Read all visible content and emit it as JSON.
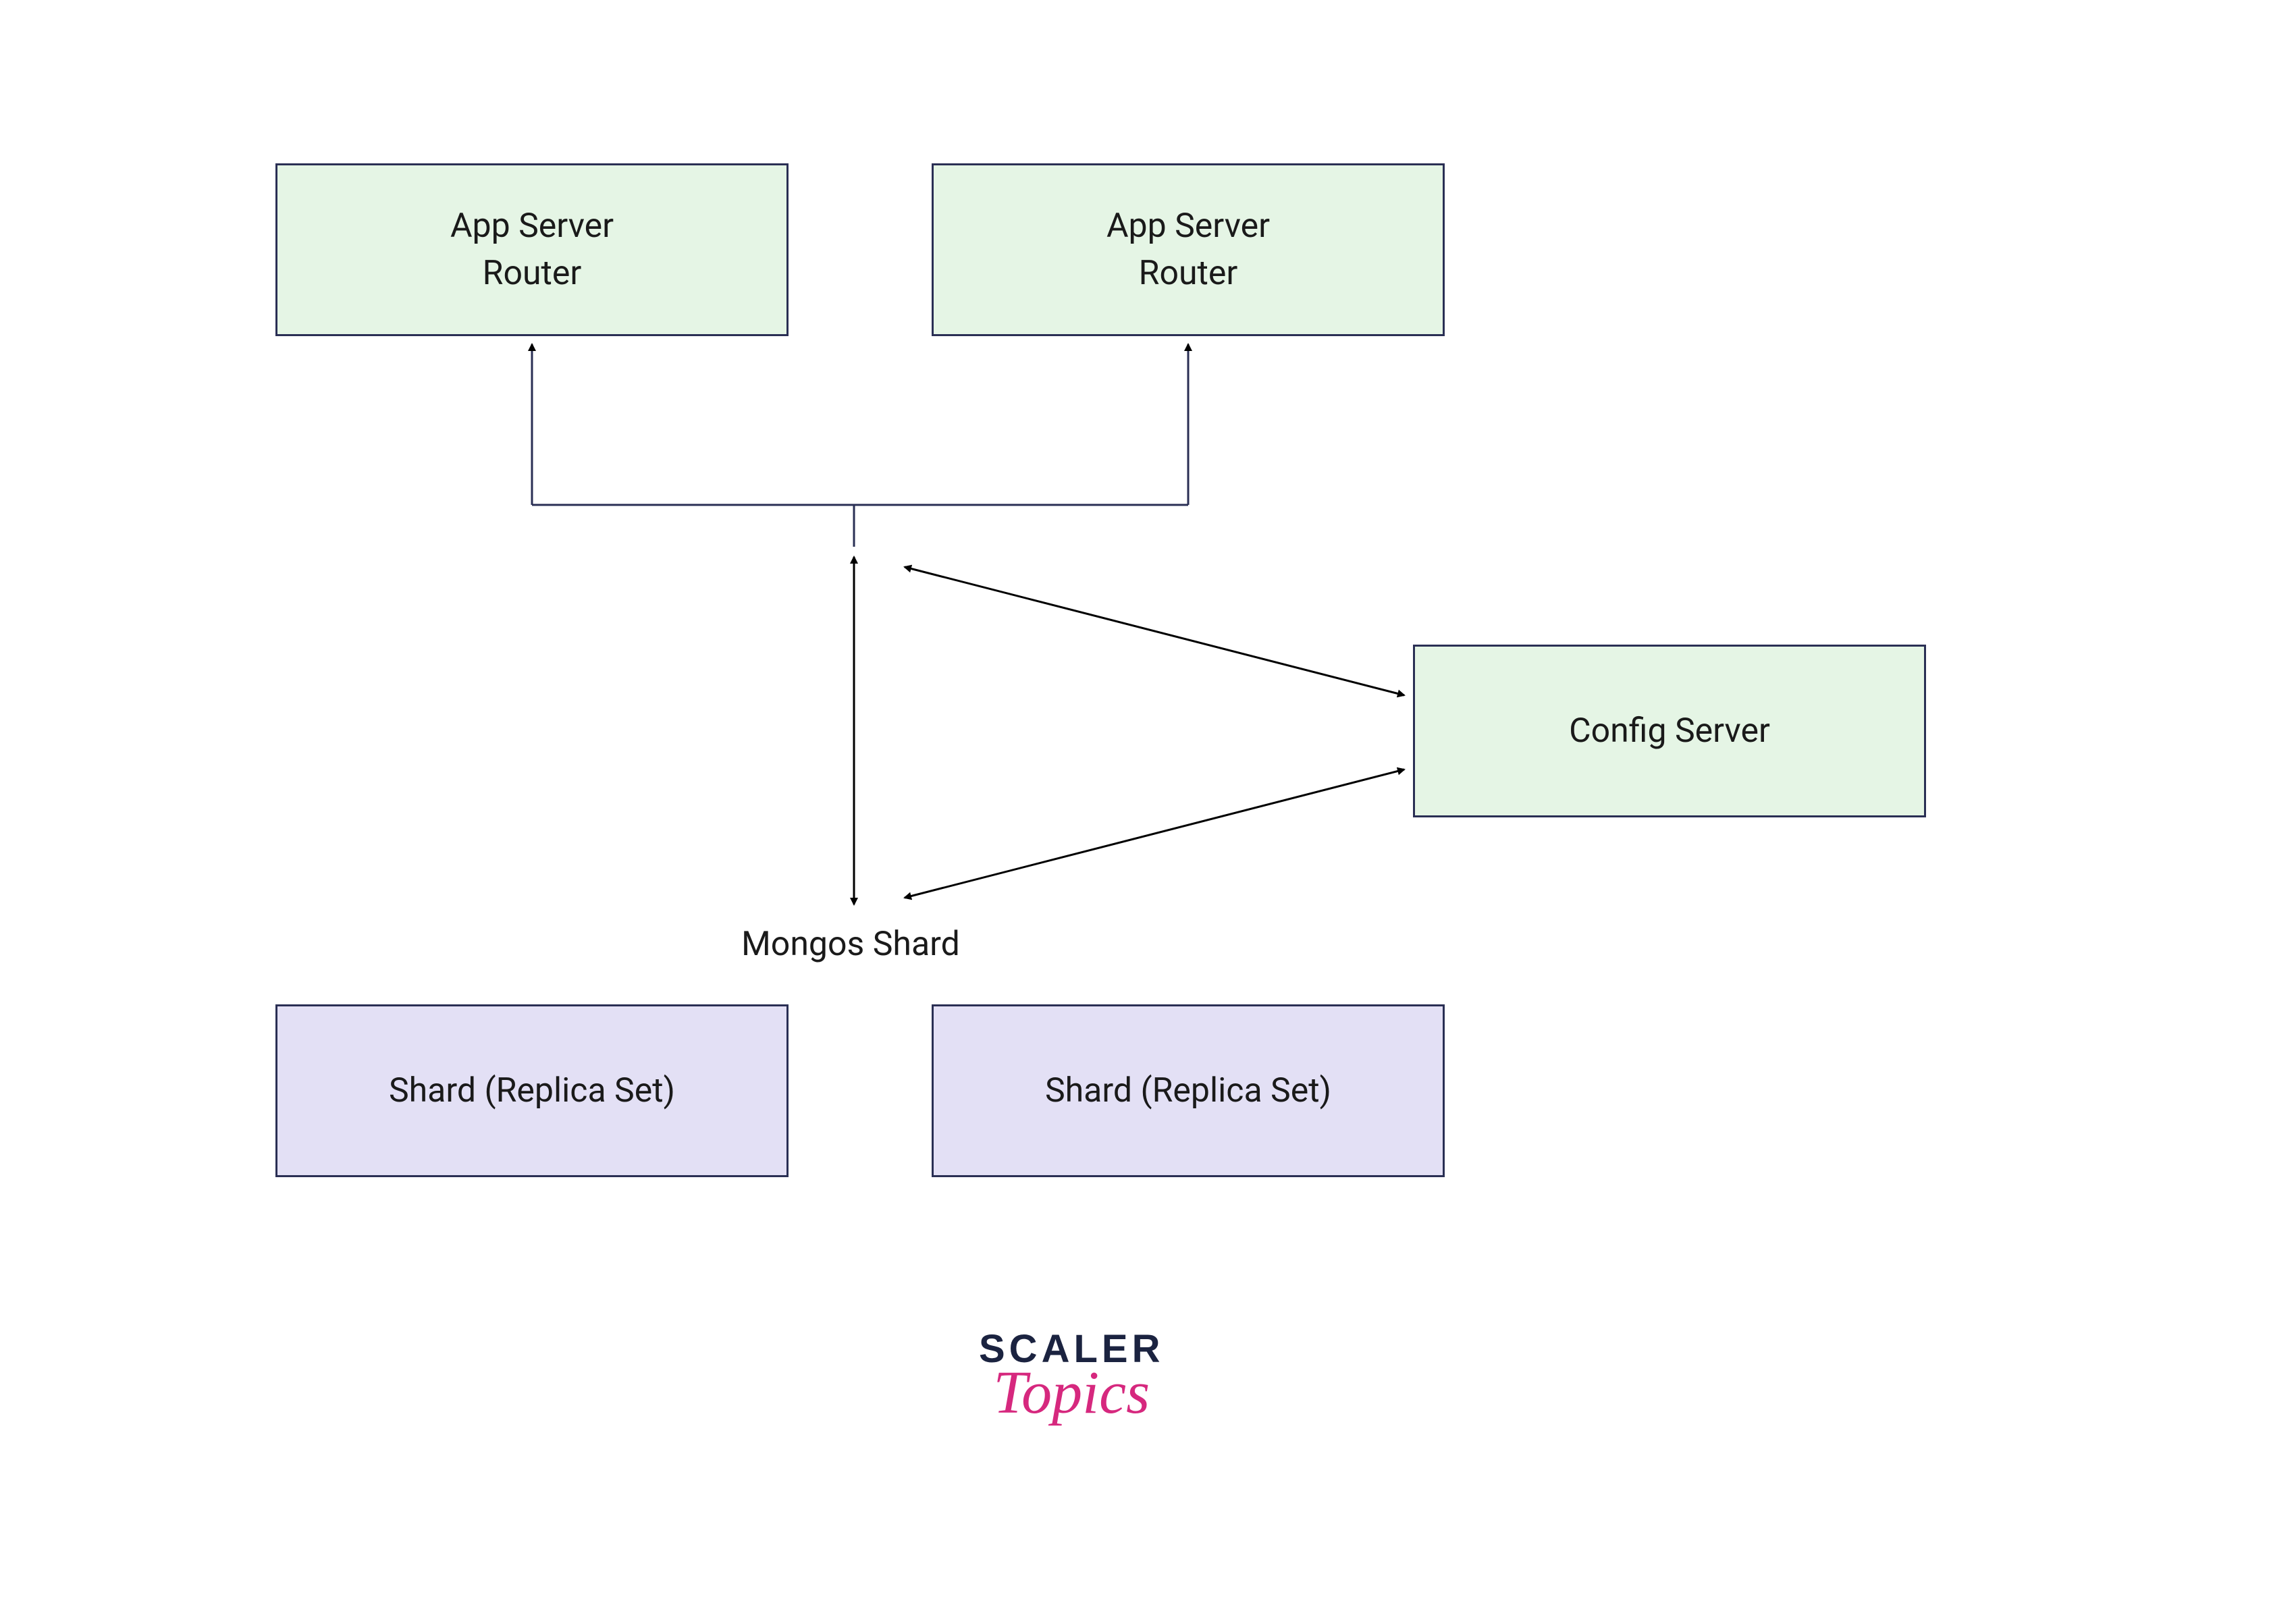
{
  "nodes": {
    "appServer1": {
      "line1": "App Server",
      "line2": "Router"
    },
    "appServer2": {
      "line1": "App Server",
      "line2": "Router"
    },
    "configServer": {
      "label": "Config Server"
    },
    "shard1": {
      "label": "Shard (Replica Set)"
    },
    "shard2": {
      "label": "Shard (Replica Set)"
    }
  },
  "centerLabel": "Mongos Shard",
  "branding": {
    "line1": "SCALER",
    "line2": "Topics"
  },
  "colors": {
    "boxBorder": "#2a2f54",
    "greenFill": "#e5f5e5",
    "purpleFill": "#e3e0f5",
    "arrowStroke": "#000000",
    "logoDark": "#1b2340",
    "logoAccent": "#d6287e"
  }
}
